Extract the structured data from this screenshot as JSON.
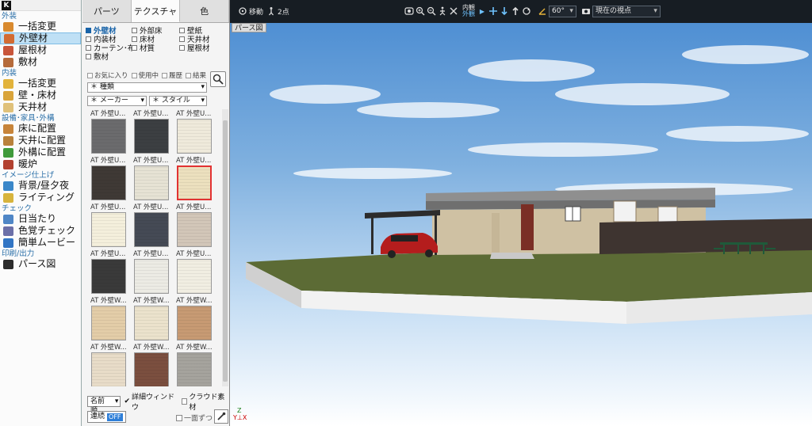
{
  "sidebar": {
    "logo": "K",
    "sections": [
      {
        "title": "外装",
        "items": [
          {
            "label": "一括変更",
            "icon": "house-paint-icon",
            "color": "#d98a2f"
          },
          {
            "label": "外壁材",
            "icon": "wall-icon",
            "color": "#d26b33",
            "active": true
          },
          {
            "label": "屋根材",
            "icon": "roof-icon",
            "color": "#c8553a"
          },
          {
            "label": "敷材",
            "icon": "paving-icon",
            "color": "#b56a3a"
          }
        ]
      },
      {
        "title": "内装",
        "items": [
          {
            "label": "一括変更",
            "icon": "interior-icon",
            "color": "#e2b33b"
          },
          {
            "label": "壁・床材",
            "icon": "floor-wall-icon",
            "color": "#d9a43a"
          },
          {
            "label": "天井材",
            "icon": "ceiling-icon",
            "color": "#e0c17a"
          }
        ]
      },
      {
        "title": "設備･家具･外構",
        "items": [
          {
            "label": "床に配置",
            "icon": "floor-place-icon",
            "color": "#c7843a"
          },
          {
            "label": "天井に配置",
            "icon": "ceiling-place-icon",
            "color": "#b9813b"
          },
          {
            "label": "外構に配置",
            "icon": "tree-icon",
            "color": "#3f9a3a"
          },
          {
            "label": "暖炉",
            "icon": "fireplace-icon",
            "color": "#b2412f"
          }
        ]
      },
      {
        "title": "イメージ仕上げ",
        "items": [
          {
            "label": "背景/昼夕夜",
            "icon": "background-icon",
            "color": "#3a87c9"
          },
          {
            "label": "ライティング",
            "icon": "bulb-icon",
            "color": "#d7b43c"
          }
        ]
      },
      {
        "title": "チェック",
        "items": [
          {
            "label": "日当たり",
            "icon": "sun-icon",
            "color": "#4f86c6"
          },
          {
            "label": "色覚チェック",
            "icon": "color-check-icon",
            "color": "#6b6fa8"
          },
          {
            "label": "簡単ムービー",
            "icon": "movie-icon",
            "color": "#3275c4"
          }
        ]
      },
      {
        "title": "印刷/出力",
        "items": [
          {
            "label": "パース図",
            "icon": "perspective-icon",
            "color": "#2b2b2b"
          }
        ]
      }
    ]
  },
  "panel": {
    "tabs": [
      "パーツ",
      "テクスチャ",
      "色"
    ],
    "active_tab": 1,
    "categories": [
      "外壁材",
      "外部床",
      "壁紙",
      "内装材",
      "床材",
      "天井材",
      "カーテン･布",
      "材質",
      "屋根材",
      "敷材"
    ],
    "selected_category": 0,
    "filters": [
      "お気に入り",
      "使用中",
      "履歴",
      "結果"
    ],
    "type_dropdown": "＊ 種類",
    "maker_dropdown": "＊ メーカー",
    "style_dropdown": "＊ スタイル",
    "tiles": [
      {
        "label": "AT 外壁U...",
        "color": "#6b6b6d"
      },
      {
        "label": "AT 外壁U...",
        "color": "#3c3f42"
      },
      {
        "label": "AT 外壁U...",
        "color": "#efeadb"
      },
      {
        "label": "AT 外壁U...",
        "color": "#3f3935"
      },
      {
        "label": "AT 外壁U...",
        "color": "#e6e2d4"
      },
      {
        "label": "AT 外壁U...",
        "color": "#ece0be",
        "selected": true
      },
      {
        "label": "AT 外壁U...",
        "color": "#f4efdc"
      },
      {
        "label": "AT 外壁U...",
        "color": "#454a55"
      },
      {
        "label": "AT 外壁U...",
        "color": "#d2c6b8"
      },
      {
        "label": "AT 外壁U...",
        "color": "#3a3a3a"
      },
      {
        "label": "AT 外壁U...",
        "color": "#ecebe4"
      },
      {
        "label": "AT 外壁U...",
        "color": "#f1eee2"
      },
      {
        "label": "AT 外壁W...",
        "color": "#e3cda8"
      },
      {
        "label": "AT 外壁W...",
        "color": "#ebe2cc"
      },
      {
        "label": "AT 外壁W...",
        "color": "#c79a73"
      },
      {
        "label": "AT 外壁W...",
        "color": "#e8dcc8"
      },
      {
        "label": "AT 外壁W...",
        "color": "#7b4f3f"
      },
      {
        "label": "AT 外壁W...",
        "color": "#a5a39d"
      }
    ],
    "sort": "名前順",
    "detail_window": "詳細ウィンドウ",
    "cloud": "クラウド素材",
    "continuous": "連続",
    "off_badge": "OFF",
    "one_face": "一面ずつ"
  },
  "toolbar": {
    "move": "移動",
    "two_point": "2点",
    "inner_view": "内観",
    "outer_view": "外観",
    "angle": "60°",
    "viewpoint": "現在の視点"
  },
  "viewport": {
    "label": "パース図",
    "axis_z": "Z",
    "axis_yx": "Y⊥X"
  }
}
